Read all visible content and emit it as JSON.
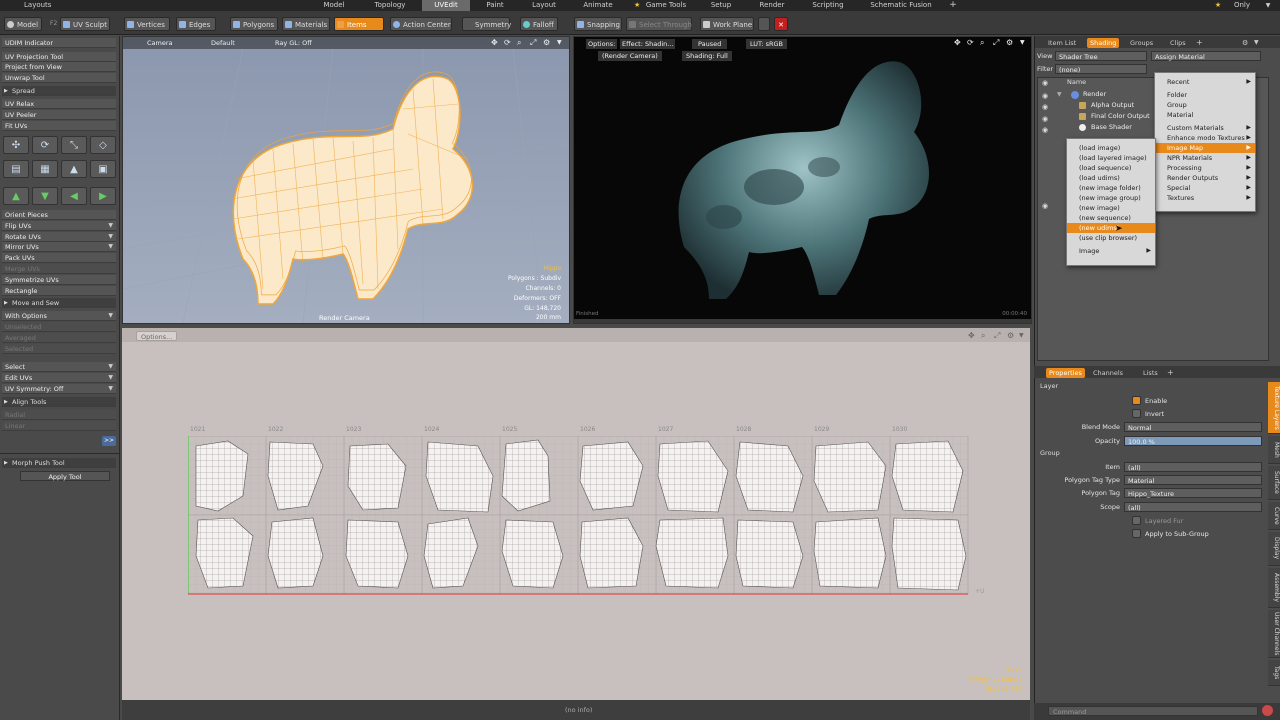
{
  "topbar": {
    "layouts": "Layouts",
    "tabs": [
      "Model",
      "Topology",
      "UVEdit",
      "Paint",
      "Layout",
      "Animate",
      "Game Tools",
      "Setup",
      "Render",
      "Scripting",
      "Schematic Fusion",
      "+"
    ],
    "active_tab": "UVEdit",
    "only": "Only"
  },
  "toolbar": {
    "model": "Model",
    "f2": "F2",
    "uv_sculpt": "UV Sculpt",
    "vertices": "Vertices",
    "edges": "Edges",
    "polygons": "Polygons",
    "materials": "Materials",
    "items": "Items",
    "action_center": "Action Center",
    "symmetry": "Symmetry",
    "falloff": "Falloff",
    "snapping": "Snapping",
    "select_through": "Select Through",
    "work_plane": "Work Plane"
  },
  "leftpanel": {
    "udim_indicator": "UDIM Indicator",
    "uv_projection_tool": "UV Projection Tool",
    "project_from_view": "Project from View",
    "unwrap_tool": "Unwrap Tool",
    "spread": "Spread",
    "uv_relax": "UV Relax",
    "uv_peeler": "UV Peeler",
    "fit_uvs": "Fit UVs",
    "orient_pieces": "Orient Pieces",
    "flip_uvs": "Flip UVs",
    "rotate_uvs": "Rotate UVs",
    "mirror_uvs": "Mirror UVs",
    "pack_uvs": "Pack UVs",
    "merge_uvs": "Merge UVs",
    "symmetrize_uvs": "Symmetrize UVs",
    "rectangle": "Rectangle",
    "move_and_sew": "Move and Sew",
    "with_options": "With Options",
    "unselected": "Unselected",
    "averaged": "Averaged",
    "selected": "Selected",
    "select": "Select",
    "edit_uvs": "Edit UVs",
    "uv_symmetry": "UV Symmetry: Off",
    "align_tools": "Align Tools",
    "radial": "Radial",
    "linear": "Linear",
    "morph_push_tool": "Morph Push Tool",
    "apply_tool": "Apply Tool",
    "expand": ">>"
  },
  "viewport_left": {
    "camera": "Camera",
    "default": "Default",
    "ray_gl": "Ray GL: Off",
    "name": "Hippo",
    "polygons": "Polygons : Subdiv",
    "channels": "Channels: 0",
    "deformers": "Deformers: OFF",
    "gl": "GL: 148,720",
    "size": "200 mm",
    "bottom_label": "Render Camera"
  },
  "viewport_right": {
    "options": "Options:",
    "effect": "Effect: Shadin...",
    "paused": "Paused",
    "lut": "LUT: sRGB",
    "render_camera": "(Render Camera)",
    "shading": "Shading: Full",
    "finished": "Finished",
    "time": "00:00:40"
  },
  "uv_editor": {
    "options": "Options...",
    "tiles": [
      "1021",
      "1022",
      "1023",
      "1024",
      "1025",
      "1026",
      "1027",
      "1028",
      "1029",
      "1030"
    ],
    "stat_name": "Hippo",
    "stat_polys": "Polygons : Subdiv",
    "stat_gl": "GL: 148,720",
    "u_label": "+U"
  },
  "bottombar": {
    "no_info": "(no info)"
  },
  "rightpanel": {
    "tabs": [
      "Item List",
      "Shading",
      "Groups",
      "Clips"
    ],
    "active_tab": "Shading",
    "view_label": "View",
    "view_value": "Shader Tree",
    "assign_material": "Assign Material",
    "filter_label": "Filter",
    "filter_value": "(none)",
    "col_name": "Name",
    "tree": [
      "Render",
      "Alpha Output",
      "Final Color Output",
      "Base Shader"
    ],
    "menu_main": [
      "Recent",
      "Folder",
      "Group",
      "Material",
      "Custom Materials",
      "Enhance modo Textures",
      "Image Map",
      "NPR Materials",
      "Processing",
      "Render Outputs",
      "Special",
      "Textures"
    ],
    "menu_main_selected": "Image Map",
    "menu_sub": [
      "(load image)",
      "(load layered image)",
      "(load sequence)",
      "(load udims)",
      "(new image folder)",
      "(new image group)",
      "(new image)",
      "(new sequence)",
      "(new udims)",
      "(use clip browser)",
      "Image"
    ],
    "menu_sub_selected": "(new udims)",
    "prop_tabs": [
      "Properties",
      "Channels",
      "Lists"
    ],
    "prop_active": "Properties",
    "layer": "Layer",
    "enable": "Enable",
    "invert": "Invert",
    "blend_mode_label": "Blend Mode",
    "blend_mode_value": "Normal",
    "opacity_label": "Opacity",
    "opacity_value": "100.0 %",
    "group": "Group",
    "item_label": "Item",
    "item_value": "(all)",
    "ptag_type_label": "Polygon Tag Type",
    "ptag_type_value": "Material",
    "ptag_label": "Polygon Tag",
    "ptag_value": "Hippo_Texture",
    "scope_label": "Scope",
    "scope_value": "(all)",
    "layered_fur": "Layered Fur",
    "apply_subgroup": "Apply to Sub-Group",
    "side_tabs": [
      "Texture Layers",
      "Mesh",
      "Surface",
      "Curve",
      "Display",
      "Assembly",
      "User Channels",
      "Tags"
    ],
    "command": "Command"
  },
  "colors": {
    "accent": "#e8891b",
    "mesh": "#f0a63a"
  }
}
